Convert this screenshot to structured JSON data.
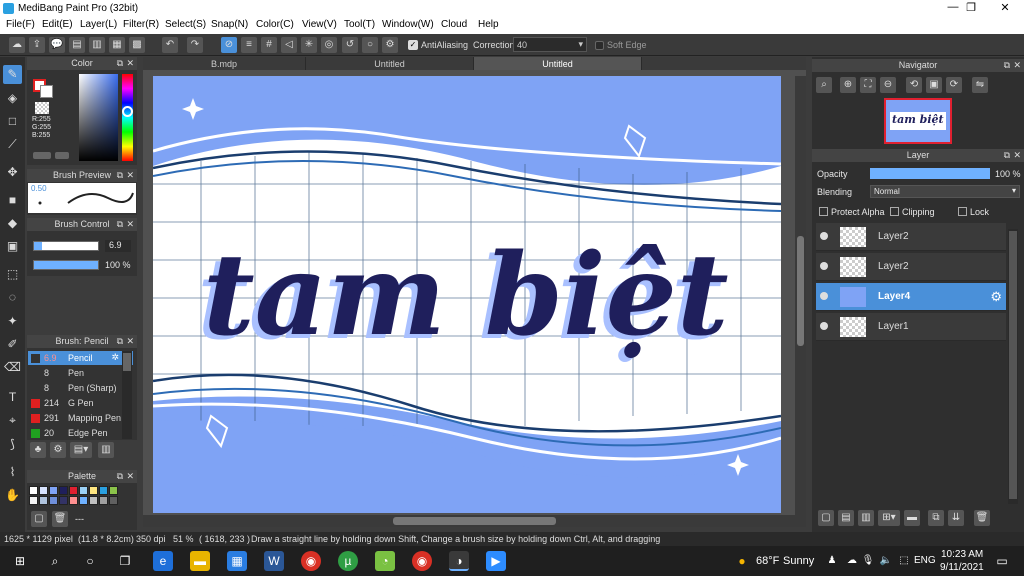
{
  "window": {
    "title": "MediBang Paint Pro (32bit)",
    "min": "—",
    "max": "❐",
    "close": "✕"
  },
  "menu": [
    "File(F)",
    "Edit(E)",
    "Layer(L)",
    "Filter(R)",
    "Select(S)",
    "Snap(N)",
    "Color(C)",
    "View(V)",
    "Tool(T)",
    "Window(W)",
    "Cloud",
    "Help"
  ],
  "toolbar": {
    "antialiasing_label": "AntiAliasing",
    "correction_label": "Correction",
    "correction_value": "40",
    "soft_edge_label": "Soft Edge"
  },
  "tabs": [
    {
      "label": "B.mdp"
    },
    {
      "label": "Untitled"
    },
    {
      "label": "Untitled"
    }
  ],
  "color_panel": {
    "title": "Color",
    "r": "R:255",
    "g": "G:255",
    "b": "B:255",
    "hex": "#FFFFFF"
  },
  "brush_preview": {
    "title": "Brush Preview",
    "size": "0.50"
  },
  "brush_control": {
    "title": "Brush Control",
    "size_value": "6.9",
    "opacity_value": "100 %"
  },
  "brush_list": {
    "title": "Brush: Pencil",
    "items": [
      {
        "size": "6.9",
        "name": "Pencil",
        "color": "#333333"
      },
      {
        "size": "8",
        "name": "Pen",
        "color": "#333333"
      },
      {
        "size": "8",
        "name": "Pen (Sharp)",
        "color": "#333333"
      },
      {
        "size": "214",
        "name": "G Pen",
        "color": "#e02020"
      },
      {
        "size": "291",
        "name": "Mapping Pen",
        "color": "#e02020"
      },
      {
        "size": "20",
        "name": "Edge Pen",
        "color": "#20a020"
      }
    ]
  },
  "palette": {
    "title": "Palette",
    "footer": "---"
  },
  "canvas": {
    "text": "tam biệt"
  },
  "navigator": {
    "title": "Navigator"
  },
  "layer_panel": {
    "title": "Layer",
    "opacity_label": "Opacity",
    "opacity_value": "100 %",
    "blending_label": "Blending",
    "blending_value": "Normal",
    "protect_alpha": "Protect Alpha",
    "clipping": "Clipping",
    "lock": "Lock",
    "layers": [
      {
        "name": "Layer2"
      },
      {
        "name": "Layer2"
      },
      {
        "name": "Layer4"
      },
      {
        "name": "Layer1"
      }
    ]
  },
  "status": {
    "size": "1625 * 1129 pixel",
    "cm": "(11.8 * 8.2cm)",
    "dpi": "350 dpi",
    "zoom": "51 %",
    "coords": "( 1618, 233 )",
    "hint": "Draw a straight line by holding down Shift, Change a brush size by holding down Ctrl, Alt, and dragging"
  },
  "taskbar": {
    "weather_temp": "68°F",
    "weather_desc": "Sunny",
    "lang": "ENG",
    "time": "10:23 AM",
    "date": "9/11/2021"
  },
  "colors": {
    "accent": "#4a90d9",
    "canvas_bg": "#7fa3f5",
    "ink": "#1f1f5c"
  }
}
